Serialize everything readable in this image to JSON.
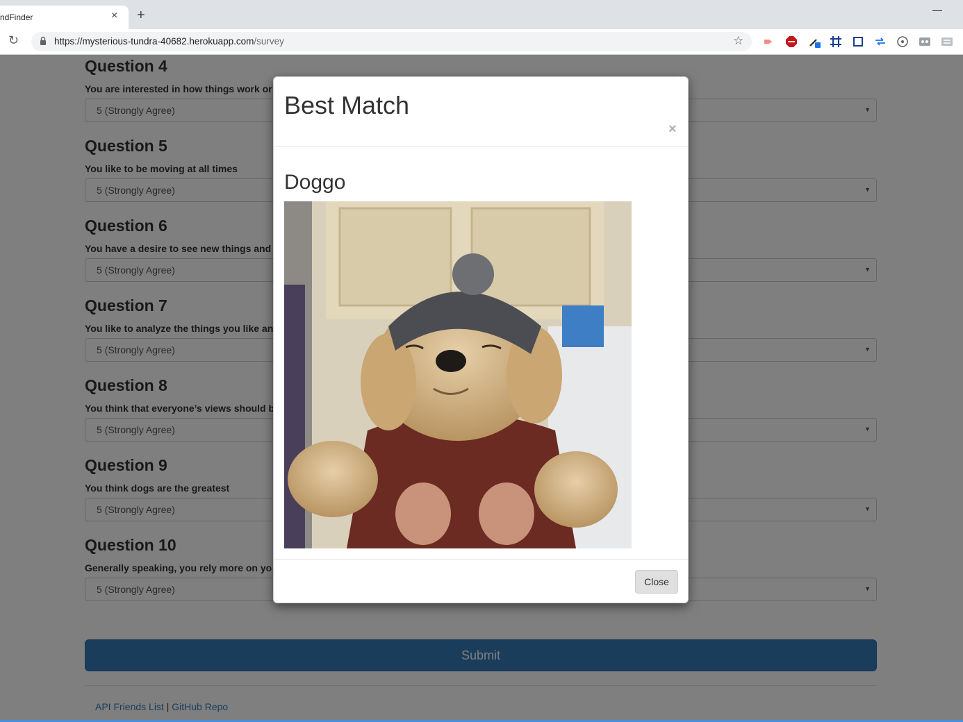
{
  "browser": {
    "tab_title": "ndFinder",
    "tab_close_glyph": "×",
    "new_tab_glyph": "+",
    "minimize_glyph": "—",
    "reload_glyph": "↻",
    "url_host": "https://mysterious-tundra-40682.herokuapp.com",
    "url_path": "/survey",
    "bookmark_glyph": "☆"
  },
  "survey": {
    "questions": [
      {
        "heading": "Question 4",
        "text": "You are interested in how things work or",
        "selected": "5 (Strongly Agree)"
      },
      {
        "heading": "Question 5",
        "text": "You like to be moving at all times",
        "selected": "5 (Strongly Agree)"
      },
      {
        "heading": "Question 6",
        "text": "You have a desire to see new things and",
        "selected": "5 (Strongly Agree)"
      },
      {
        "heading": "Question 7",
        "text": "You like to analyze the things you like an",
        "selected": "5 (Strongly Agree)"
      },
      {
        "heading": "Question 8",
        "text": "You think that everyone’s views should b",
        "selected": "5 (Strongly Agree)"
      },
      {
        "heading": "Question 9",
        "text": "You think dogs are the greatest",
        "selected": "5 (Strongly Agree)"
      },
      {
        "heading": "Question 10",
        "text": "Generally speaking, you rely more on yo",
        "selected": "5 (Strongly Agree)"
      }
    ],
    "select_arrow": "▼",
    "submit_label": "Submit"
  },
  "footer": {
    "link_api": "API Friends List",
    "separator": " | ",
    "link_github": "GitHub Repo"
  },
  "modal": {
    "title": "Best Match",
    "close_x": "×",
    "match_name": "Doggo",
    "close_label": "Close"
  },
  "colors": {
    "primary": "#337ab7",
    "backdrop": "rgba(0,0,0,0.5)"
  }
}
